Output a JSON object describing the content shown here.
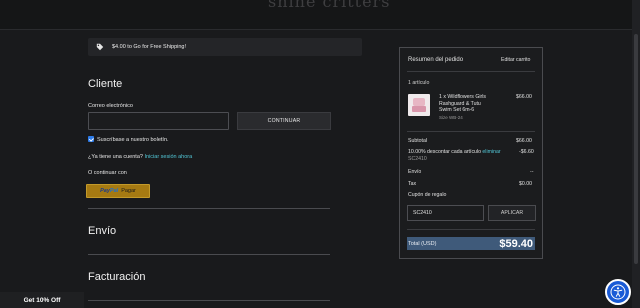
{
  "header": {
    "logo_text": "shine critters"
  },
  "shipping_banner": {
    "text": "$4.00 to Go for Free Shipping!"
  },
  "customer": {
    "title": "Cliente",
    "email_label": "Correo electrónico",
    "email_value": "",
    "continue_label": "CONTINUAR",
    "subscribe_label": "Suscríbase a nuestro boletín.",
    "account_prompt": "¿Ya tiene una cuenta?",
    "signin_link": "Iniciar sesión ahora",
    "or_continue": "O continuar con",
    "paypal_brand_1": "Pay",
    "paypal_brand_2": "Pal",
    "paypal_action": "Pagar"
  },
  "sections": {
    "shipping": "Envío",
    "billing": "Facturación"
  },
  "summary": {
    "title": "Resumen del pedido",
    "edit_cart": "Editar carrito",
    "item_count": "1 artículo",
    "item": {
      "line1": "1 x Wildflowers Girls",
      "line2": "Rashguard & Tutu",
      "line3": "Swim Set 6m-6",
      "size": "Size WB-24",
      "price": "$66.00"
    },
    "subtotal_label": "Subtotal",
    "subtotal_value": "$66.00",
    "discount_label": "10.00% descontar cada artículo",
    "discount_remove": "eliminar",
    "discount_value": "-$6.60",
    "discount_code": "SC2410",
    "shipping_label": "Envío",
    "shipping_value": "--",
    "tax_label": "Tax",
    "tax_value": "$0.00",
    "coupon_label": "Cupón de regalo",
    "coupon_value": "SC2410",
    "apply_label": "APLICAR",
    "total_label": "Total (USD)",
    "total_value": "$59.40"
  },
  "promo": {
    "text": "Get 10% Off"
  },
  "colors": {
    "accent_link": "#52c8d8",
    "checkbox": "#2d7be8",
    "paypal": "#a67a12",
    "total_bar": "#3f5a7a",
    "a11y": "#1a5bd6"
  },
  "icons": {
    "shipping": "tag-icon",
    "accessibility": "accessibility-icon"
  }
}
